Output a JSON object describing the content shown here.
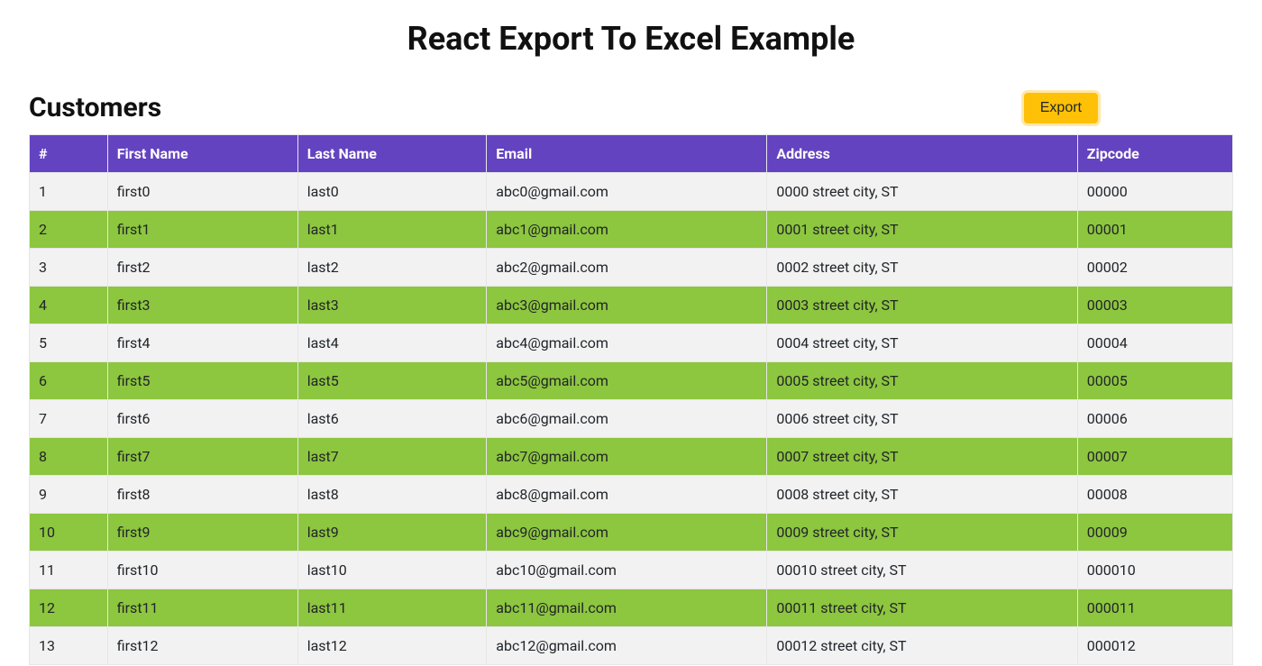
{
  "page": {
    "title": "React Export To Excel Example"
  },
  "section": {
    "title": "Customers",
    "export_label": "Export"
  },
  "table": {
    "headers": {
      "idx": "#",
      "first": "First Name",
      "last": "Last Name",
      "email": "Email",
      "address": "Address",
      "zip": "Zipcode"
    },
    "rows": [
      {
        "idx": "1",
        "first": "first0",
        "last": "last0",
        "email": "abc0@gmail.com",
        "address": "0000 street city, ST",
        "zip": "00000"
      },
      {
        "idx": "2",
        "first": "first1",
        "last": "last1",
        "email": "abc1@gmail.com",
        "address": "0001 street city, ST",
        "zip": "00001"
      },
      {
        "idx": "3",
        "first": "first2",
        "last": "last2",
        "email": "abc2@gmail.com",
        "address": "0002 street city, ST",
        "zip": "00002"
      },
      {
        "idx": "4",
        "first": "first3",
        "last": "last3",
        "email": "abc3@gmail.com",
        "address": "0003 street city, ST",
        "zip": "00003"
      },
      {
        "idx": "5",
        "first": "first4",
        "last": "last4",
        "email": "abc4@gmail.com",
        "address": "0004 street city, ST",
        "zip": "00004"
      },
      {
        "idx": "6",
        "first": "first5",
        "last": "last5",
        "email": "abc5@gmail.com",
        "address": "0005 street city, ST",
        "zip": "00005"
      },
      {
        "idx": "7",
        "first": "first6",
        "last": "last6",
        "email": "abc6@gmail.com",
        "address": "0006 street city, ST",
        "zip": "00006"
      },
      {
        "idx": "8",
        "first": "first7",
        "last": "last7",
        "email": "abc7@gmail.com",
        "address": "0007 street city, ST",
        "zip": "00007"
      },
      {
        "idx": "9",
        "first": "first8",
        "last": "last8",
        "email": "abc8@gmail.com",
        "address": "0008 street city, ST",
        "zip": "00008"
      },
      {
        "idx": "10",
        "first": "first9",
        "last": "last9",
        "email": "abc9@gmail.com",
        "address": "0009 street city, ST",
        "zip": "00009"
      },
      {
        "idx": "11",
        "first": "first10",
        "last": "last10",
        "email": "abc10@gmail.com",
        "address": "00010 street city, ST",
        "zip": "000010"
      },
      {
        "idx": "12",
        "first": "first11",
        "last": "last11",
        "email": "abc11@gmail.com",
        "address": "00011 street city, ST",
        "zip": "000011"
      },
      {
        "idx": "13",
        "first": "first12",
        "last": "last12",
        "email": "abc12@gmail.com",
        "address": "00012 street city, ST",
        "zip": "000012"
      }
    ]
  }
}
